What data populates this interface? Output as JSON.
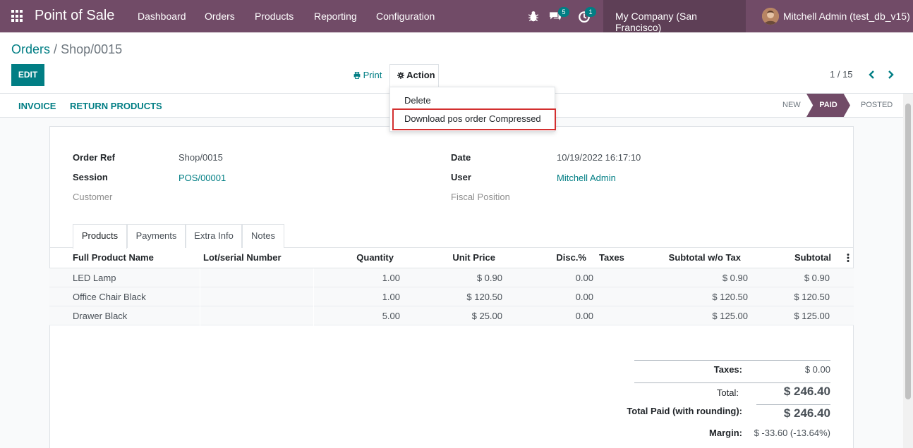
{
  "navbar": {
    "brand": "Point of Sale",
    "menu": [
      "Dashboard",
      "Orders",
      "Products",
      "Reporting",
      "Configuration"
    ],
    "messages_badge": "5",
    "activities_badge": "1",
    "company": "My Company (San Francisco)",
    "user": "Mitchell Admin (test_db_v15)"
  },
  "breadcrumb": {
    "parent": "Orders",
    "separator": "/",
    "current": "Shop/0015"
  },
  "controls": {
    "edit_label": "EDIT",
    "print_label": "Print",
    "action_label": "Action",
    "pager": "1 / 15"
  },
  "action_menu": {
    "items": [
      "Delete",
      "Download pos order Compressed"
    ]
  },
  "statusbar": {
    "buttons": [
      "INVOICE",
      "RETURN PRODUCTS"
    ],
    "stages": [
      "NEW",
      "PAID",
      "POSTED"
    ],
    "active_stage": "PAID"
  },
  "form": {
    "order_ref_label": "Order Ref",
    "order_ref": "Shop/0015",
    "session_label": "Session",
    "session": "POS/00001",
    "customer_label": "Customer",
    "date_label": "Date",
    "date": "10/19/2022 16:17:10",
    "user_label": "User",
    "user": "Mitchell Admin",
    "fiscal_label": "Fiscal Position"
  },
  "tabs": [
    "Products",
    "Payments",
    "Extra Info",
    "Notes"
  ],
  "table": {
    "headers": [
      "Full Product Name",
      "Lot/serial Number",
      "Quantity",
      "Unit Price",
      "Disc.%",
      "Taxes",
      "Subtotal w/o Tax",
      "Subtotal"
    ],
    "rows": [
      [
        "LED Lamp",
        "",
        "1.00",
        "$ 0.90",
        "0.00",
        "",
        "$ 0.90",
        "$ 0.90"
      ],
      [
        "Office Chair Black",
        "",
        "1.00",
        "$ 120.50",
        "0.00",
        "",
        "$ 120.50",
        "$ 120.50"
      ],
      [
        "Drawer Black",
        "",
        "5.00",
        "$ 25.00",
        "0.00",
        "",
        "$ 125.00",
        "$ 125.00"
      ]
    ]
  },
  "totals": {
    "taxes_label": "Taxes:",
    "taxes": "$ 0.00",
    "total_label": "Total:",
    "total": "$ 246.40",
    "paid_label": "Total Paid (with rounding):",
    "paid": "$ 246.40",
    "margin_label": "Margin:",
    "margin": "$ -33.60 (-13.64%)"
  },
  "colors": {
    "brand": "#714B67",
    "accent": "#017e84",
    "highlight": "#d32f2f"
  }
}
